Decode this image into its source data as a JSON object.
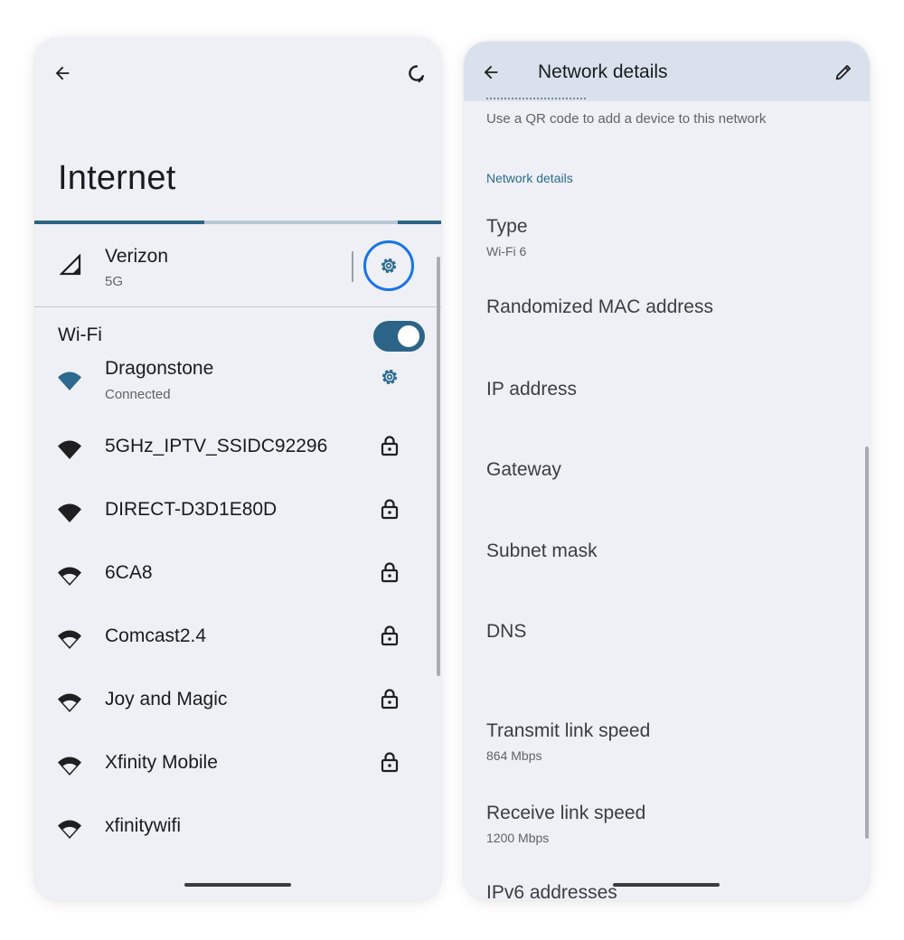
{
  "left": {
    "title": "Internet",
    "mobile": {
      "name": "Verizon",
      "type": "5G"
    },
    "wifi_label": "Wi-Fi",
    "wifi_enabled": true,
    "networks": [
      {
        "name": "Dragonstone",
        "status": "Connected",
        "icon": "wifi-icon",
        "action_icon": "gear-icon"
      },
      {
        "name": "5GHz_IPTV_SSIDC92296",
        "status": "",
        "icon": "wifi-icon",
        "action_icon": "lock-icon"
      },
      {
        "name": "DIRECT-D3D1E80D",
        "status": "",
        "icon": "wifi-icon",
        "action_icon": "lock-icon"
      },
      {
        "name": "6CA8",
        "status": "",
        "icon": "wifi-icon",
        "action_icon": "lock-icon"
      },
      {
        "name": "Comcast2.4",
        "status": "",
        "icon": "wifi-icon",
        "action_icon": "lock-icon"
      },
      {
        "name": "Joy and Magic",
        "status": "",
        "icon": "wifi-icon",
        "action_icon": "lock-icon"
      },
      {
        "name": "Xfinity Mobile",
        "status": "",
        "icon": "wifi-icon",
        "action_icon": "lock-icon"
      },
      {
        "name": "xfinitywifi",
        "status": "",
        "icon": "wifi-icon",
        "action_icon": ""
      }
    ]
  },
  "right": {
    "title": "Network details",
    "share_hint": "Use a QR code to add a device to this network",
    "section_header": "Network details",
    "details": [
      {
        "label": "Type",
        "value": "Wi-Fi 6"
      },
      {
        "label": "Randomized MAC address",
        "value": ""
      },
      {
        "label": "IP address",
        "value": ""
      },
      {
        "label": "Gateway",
        "value": ""
      },
      {
        "label": "Subnet mask",
        "value": ""
      },
      {
        "label": "DNS",
        "value": ""
      },
      {
        "label": "Transmit link speed",
        "value": "864 Mbps"
      },
      {
        "label": "Receive link speed",
        "value": "1200 Mbps"
      },
      {
        "label": "IPv6 addresses",
        "value": ""
      }
    ]
  },
  "colors": {
    "accent": "#2d6a8f",
    "highlight_ring": "#1a73e8",
    "background": "#eef0f5",
    "app_bar": "#d9e2ec"
  }
}
